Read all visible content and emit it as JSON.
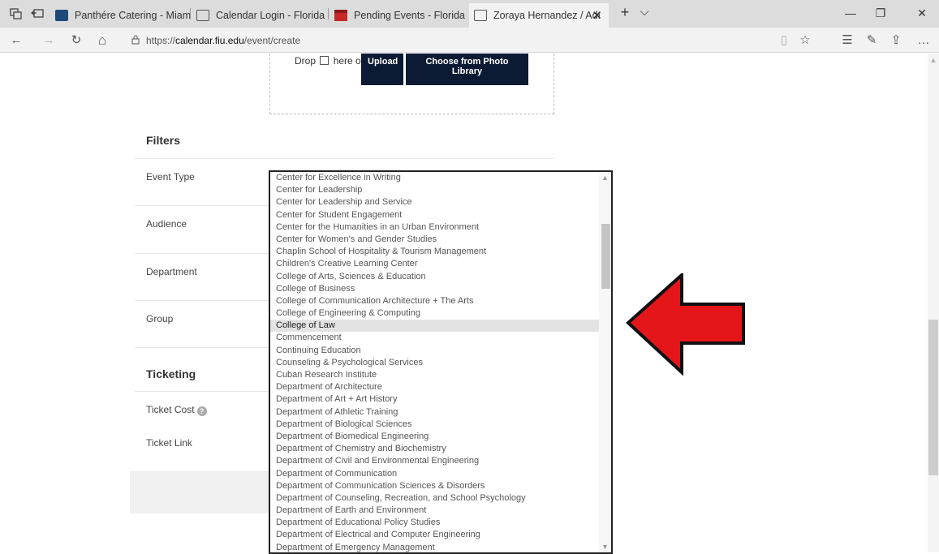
{
  "browser": {
    "tabs": [
      {
        "title": "Panthére Catering - Miami,"
      },
      {
        "title": "Calendar Login - Florida Int"
      },
      {
        "title": "Pending Events - Florida Int"
      },
      {
        "title": "Zoraya Hernandez / Adı"
      }
    ],
    "new_tab_glyph": "+",
    "tab_list_glyph": "⌵",
    "close_glyph": "✕",
    "url_prefix": "https://",
    "url_host": "calendar.fiu.edu",
    "url_path": "/event/create",
    "window": {
      "minimize": "—",
      "maximize": "❐",
      "close": "✕"
    },
    "nav": {
      "back": "←",
      "forward": "→",
      "refresh": "↻",
      "home": "⌂",
      "reading": "▯",
      "favorite": "☆",
      "favorites_hub": "☰",
      "notes": "✎",
      "share": "⇪",
      "more": "…"
    },
    "icons": [
      "tab-preview-icon",
      "set-aside-tabs-icon",
      "site-favicon",
      "calendar-favicon",
      "red-favicon",
      "lock-icon",
      "image-icon",
      "help-icon"
    ]
  },
  "upload": {
    "drop_prefix": "Drop",
    "drop_suffix": "here or",
    "upload_label": "Upload",
    "library_label": "Choose from Photo Library"
  },
  "filters": {
    "title": "Filters",
    "event_type": "Event Type",
    "audience": "Audience",
    "department": "Department",
    "group": "Group"
  },
  "ticketing": {
    "title": "Ticketing",
    "cost": "Ticket Cost",
    "link": "Ticket Link",
    "help_glyph": "?"
  },
  "dropdown": {
    "selected": "College of Law",
    "options": [
      "Center for Excellence in Writing",
      "Center for Leadership",
      "Center for Leadership and Service",
      "Center for Student Engagement",
      "Center for the Humanities in an Urban Environment",
      "Center for Women's and Gender Studies",
      "Chaplin School of Hospitality & Tourism Management",
      "Children's Creative Learning Center",
      "College of Arts, Sciences & Education",
      "College of Business",
      "College of Communication Architecture + The Arts",
      "College of Engineering & Computing",
      "College of Law",
      "Commencement",
      "Continuing Education",
      "Counseling & Psychological Services",
      "Cuban Research Institute",
      "Department of Architecture",
      "Department of Art + Art History",
      "Department of Athletic Training",
      "Department of Biological Sciences",
      "Department of Biomedical Engineering",
      "Department of Chemistry and Biochemistry",
      "Department of Civil and Environmental Engineering",
      "Department of Communication",
      "Department of Communication Sciences & Disorders",
      "Department of Counseling, Recreation, and School Psychology",
      "Department of Earth and Environment",
      "Department of Educational Policy Studies",
      "Department of Electrical and Computer Engineering",
      "Department of Emergency Management"
    ]
  },
  "colors": {
    "dark_button": "#0c1a33",
    "annotation_arrow": "#e5161a",
    "selected_row": "#e3e3e3"
  }
}
